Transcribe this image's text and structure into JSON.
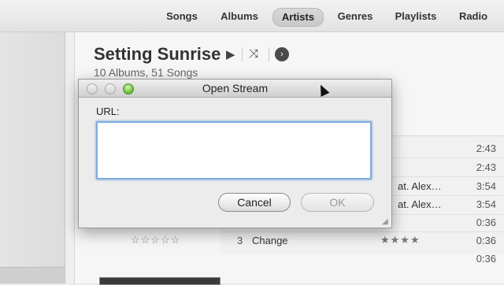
{
  "nav": {
    "tabs": [
      {
        "label": "Songs",
        "active": false
      },
      {
        "label": "Albums",
        "active": false
      },
      {
        "label": "Artists",
        "active": true
      },
      {
        "label": "Genres",
        "active": false
      },
      {
        "label": "Playlists",
        "active": false
      },
      {
        "label": "Radio",
        "active": false
      }
    ]
  },
  "artist": {
    "title": "Setting Sunrise",
    "subtitle": "10 Albums, 51 Songs",
    "play_icon": "▶",
    "shuffle_icon": "⤨",
    "more_icon": "›"
  },
  "tracks": {
    "durations": [
      "2:43",
      "2:43",
      "3:54",
      "3:54",
      "0:36",
      "0:36",
      "0:36"
    ],
    "artist_cells": [
      "at. Alex…",
      "at. Alex…"
    ],
    "visible_track": {
      "number": "3",
      "name": "Change",
      "rating": "★★★★"
    },
    "album_rating": "☆☆☆☆☆"
  },
  "dialog": {
    "title": "Open Stream",
    "url_label": "URL:",
    "url_value": "",
    "cancel_label": "Cancel",
    "ok_label": "OK",
    "grip": "◢"
  },
  "colors": {
    "focus_ring": "#7ea9dd",
    "zoom_button": "#71c23a"
  }
}
